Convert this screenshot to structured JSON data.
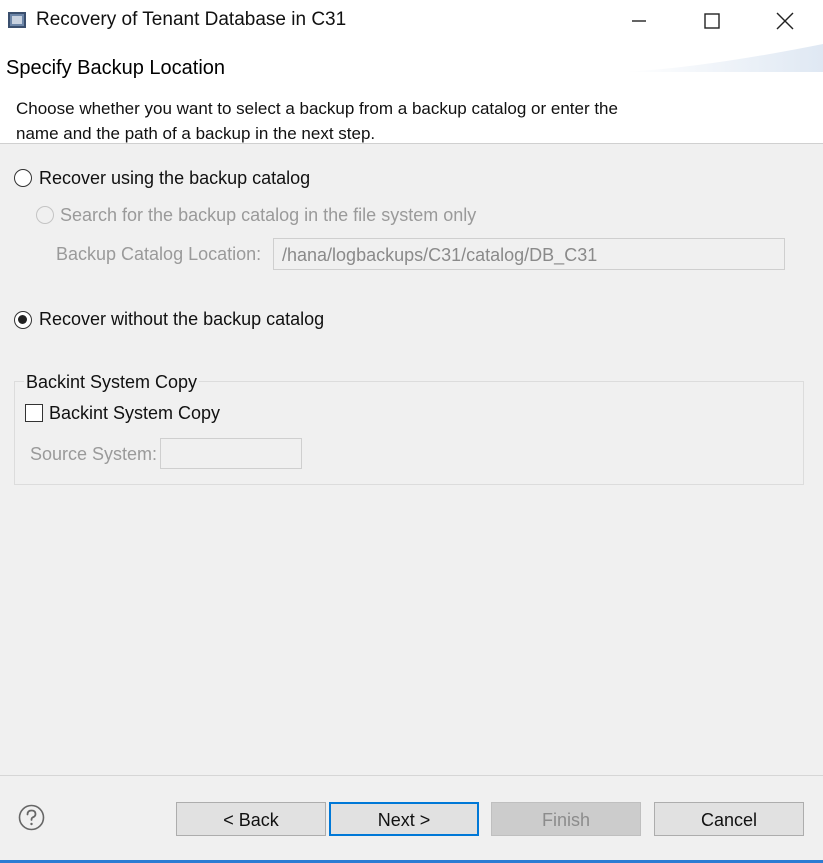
{
  "window": {
    "title": "Recovery of Tenant Database in C31",
    "icon": "database-app-icon",
    "controls": [
      "minimize-icon",
      "maximize-icon",
      "close-icon"
    ]
  },
  "header": {
    "title": "Specify Backup Location",
    "description": "Choose whether you want to select a backup from a backup catalog or enter the name and the path of a backup in the next step."
  },
  "options": {
    "catalog_radio": {
      "label": "Recover using the backup catalog",
      "selected": false
    },
    "filesystem_radio": {
      "label": "Search for the backup catalog in the file system only",
      "selected": false,
      "enabled": false
    },
    "catalog_location": {
      "label": "Backup Catalog Location:",
      "value": "/hana/logbackups/C31/catalog/DB_C31",
      "enabled": false
    },
    "no_catalog_radio": {
      "label": "Recover without the backup catalog",
      "selected": true
    }
  },
  "backint_group": {
    "title": "Backint System Copy",
    "checkbox": {
      "label": "Backint System Copy",
      "checked": false
    },
    "source_system": {
      "label": "Source System:",
      "value": "",
      "enabled": false
    }
  },
  "footer": {
    "help_icon": "help-icon",
    "back_label": "< Back",
    "next_label": "Next >",
    "finish_label": "Finish",
    "cancel_label": "Cancel"
  },
  "colors": {
    "accent": "#0078d7",
    "content_bg": "#f0f0f0",
    "disabled_text": "#9a9a9a"
  }
}
